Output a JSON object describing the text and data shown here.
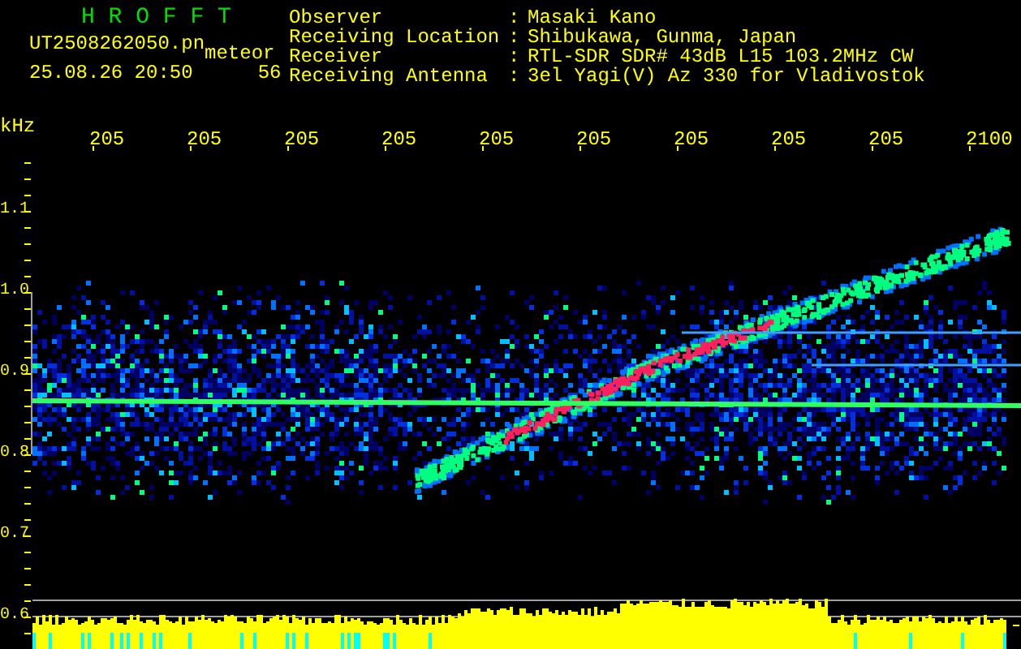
{
  "header": {
    "title": "H R O F F T",
    "file_name": "UT2508262050.pn",
    "mode": "meteor",
    "datetime": "25.08.26 20:50",
    "count": "56"
  },
  "station_info": [
    {
      "label": "Observer",
      "separator": ":",
      "value": "Masaki Kano"
    },
    {
      "label": "Receiving Location",
      "separator": ":",
      "value": "Shibukawa, Gunma, Japan"
    },
    {
      "label": "Receiver",
      "separator": ":",
      "value": "RTL-SDR SDR# 43dB L15 103.2MHz CW"
    },
    {
      "label": "Receiving Antenna",
      "separator": ":",
      "value": "3el Yagi(V) Az 330 for Vladivostok"
    }
  ],
  "x_axis": {
    "labels": [
      "205",
      "205",
      "205",
      "205",
      "205",
      "205",
      "205",
      "205",
      "205",
      "2100"
    ]
  },
  "y_axis": {
    "unit": "kHz",
    "labels": [
      "1.1",
      "1.0",
      "0.9",
      "0.8",
      "0.7",
      "0.6"
    ]
  }
}
